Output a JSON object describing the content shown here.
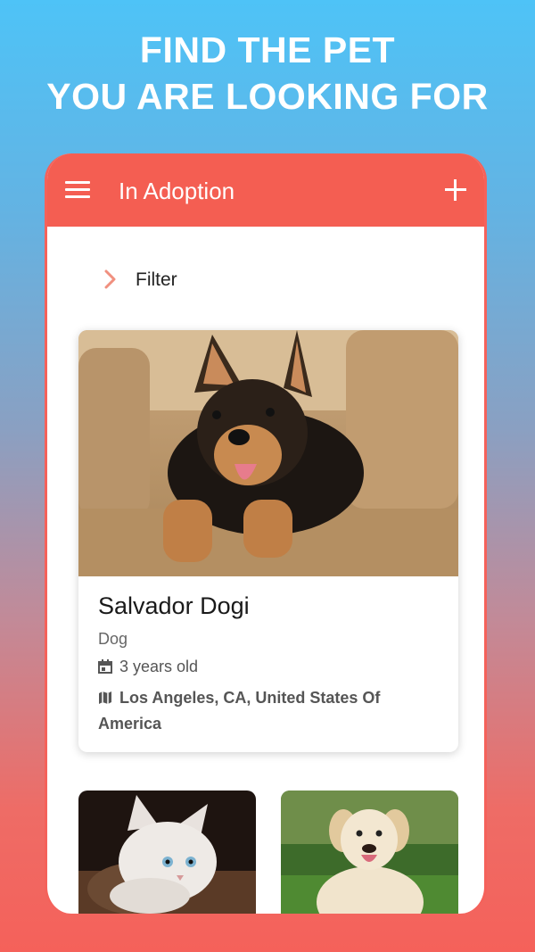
{
  "promo": {
    "line1": "FIND THE PET",
    "line2": "YOU ARE LOOKING FOR"
  },
  "appbar": {
    "title": "In Adoption",
    "menu_icon": "menu-icon",
    "add_icon": "add-icon",
    "color": "#f45e52"
  },
  "filter": {
    "label": "Filter",
    "icon": "chevron-right-icon",
    "icon_color": "#f0907f"
  },
  "featured_pet": {
    "name": "Salvador Dogi",
    "type": "Dog",
    "age": "3 years old",
    "location": "Los Angeles, CA, United States Of America",
    "age_icon": "calendar-icon",
    "location_icon": "map-icon"
  },
  "more_pets": [
    {
      "photo": "kitten-photo"
    },
    {
      "photo": "labrador-photo"
    }
  ]
}
